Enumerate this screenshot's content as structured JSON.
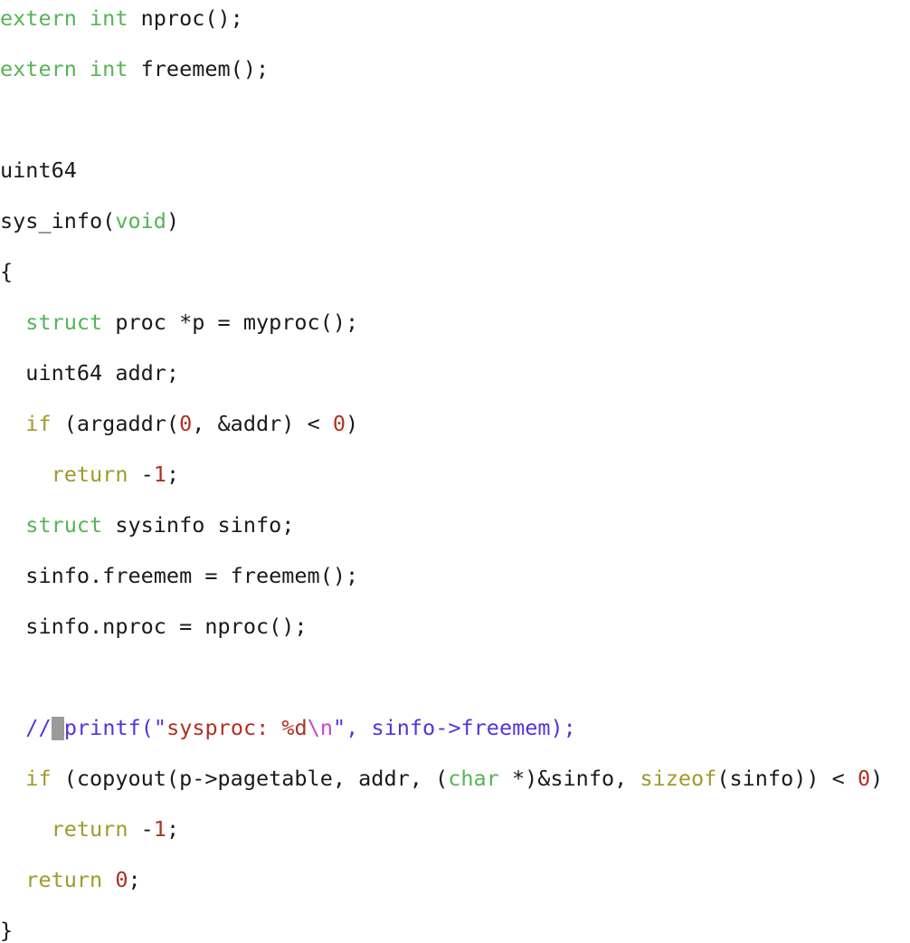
{
  "editor": {
    "background_color": "#ffffff",
    "font_size_px": 23.5,
    "line_height_px": 28,
    "cursor": {
      "name": "text-cursor-block",
      "color": "#9a9a9a",
      "line_index": 13,
      "column": 4
    }
  },
  "theme": {
    "plain": "#1a1a1a",
    "type_keyword": "#55b555",
    "control_keyword": "#a09a2c",
    "number": "#b03122",
    "comment": "#5533dd",
    "string": "#b03122",
    "escape": "#cc44cc"
  },
  "code": {
    "language": "c",
    "plain_text": "extern int nproc();\nextern int freemem();\n\nuint64\nsys_info(void)\n{\n  struct proc *p = myproc();\n  uint64 addr;\n  if (argaddr(0, &addr) < 0)\n    return -1;\n  struct sysinfo sinfo;\n  sinfo.freemem = freemem();\n  sinfo.nproc = nproc();\n\n  // printf(\"sysproc: %d\\n\", sinfo->freemem);\n  if (copyout(p->pagetable, addr, (char *)&sinfo, sizeof(sinfo)) < 0)\n    return -1;\n  return 0;\n}",
    "lines": [
      {
        "n": 1,
        "tokens": [
          {
            "t": "extern int",
            "c": "type"
          },
          {
            "t": " nproc();",
            "c": "plain"
          }
        ]
      },
      {
        "n": 2,
        "tokens": [
          {
            "t": "extern int",
            "c": "type"
          },
          {
            "t": " freemem();",
            "c": "plain"
          }
        ]
      },
      {
        "n": 3,
        "tokens": [
          {
            "t": "",
            "c": "plain"
          }
        ]
      },
      {
        "n": 4,
        "tokens": [
          {
            "t": "uint64",
            "c": "plain"
          }
        ]
      },
      {
        "n": 5,
        "tokens": [
          {
            "t": "sys_info(",
            "c": "plain"
          },
          {
            "t": "void",
            "c": "type"
          },
          {
            "t": ")",
            "c": "plain"
          }
        ]
      },
      {
        "n": 6,
        "tokens": [
          {
            "t": "{",
            "c": "plain"
          }
        ]
      },
      {
        "n": 7,
        "tokens": [
          {
            "t": "  ",
            "c": "plain"
          },
          {
            "t": "struct",
            "c": "type"
          },
          {
            "t": " proc *p = myproc();",
            "c": "plain"
          }
        ]
      },
      {
        "n": 8,
        "tokens": [
          {
            "t": "  uint64 addr;",
            "c": "plain"
          }
        ]
      },
      {
        "n": 9,
        "tokens": [
          {
            "t": "  ",
            "c": "plain"
          },
          {
            "t": "if",
            "c": "kw"
          },
          {
            "t": " (argaddr(",
            "c": "plain"
          },
          {
            "t": "0",
            "c": "num"
          },
          {
            "t": ", &addr) < ",
            "c": "plain"
          },
          {
            "t": "0",
            "c": "num"
          },
          {
            "t": ")",
            "c": "plain"
          }
        ]
      },
      {
        "n": 10,
        "tokens": [
          {
            "t": "    ",
            "c": "plain"
          },
          {
            "t": "return",
            "c": "kw"
          },
          {
            "t": " -",
            "c": "plain"
          },
          {
            "t": "1",
            "c": "num"
          },
          {
            "t": ";",
            "c": "plain"
          }
        ]
      },
      {
        "n": 11,
        "tokens": [
          {
            "t": "  ",
            "c": "plain"
          },
          {
            "t": "struct",
            "c": "type"
          },
          {
            "t": " sysinfo sinfo;",
            "c": "plain"
          }
        ]
      },
      {
        "n": 12,
        "tokens": [
          {
            "t": "  sinfo.freemem = freemem();",
            "c": "plain"
          }
        ]
      },
      {
        "n": 13,
        "tokens": [
          {
            "t": "  sinfo.nproc = nproc();",
            "c": "plain"
          }
        ]
      },
      {
        "n": 14,
        "tokens": [
          {
            "t": "",
            "c": "plain"
          }
        ]
      },
      {
        "n": 15,
        "tokens": [
          {
            "t": "  ",
            "c": "plain"
          },
          {
            "t": "//",
            "c": "comment"
          },
          {
            "t": " ",
            "c": "cursor"
          },
          {
            "t": "printf(\"",
            "c": "comment"
          },
          {
            "t": "sysproc: %d",
            "c": "string"
          },
          {
            "t": "\\n",
            "c": "escape"
          },
          {
            "t": "\", sinfo->freemem);",
            "c": "comment"
          }
        ]
      },
      {
        "n": 16,
        "tokens": [
          {
            "t": "  ",
            "c": "plain"
          },
          {
            "t": "if",
            "c": "kw"
          },
          {
            "t": " (copyout(p->pagetable, addr, (",
            "c": "plain"
          },
          {
            "t": "char",
            "c": "type"
          },
          {
            "t": " *)&sinfo, ",
            "c": "plain"
          },
          {
            "t": "sizeof",
            "c": "kw"
          },
          {
            "t": "(sinfo)) < ",
            "c": "plain"
          },
          {
            "t": "0",
            "c": "num"
          },
          {
            "t": ")",
            "c": "plain"
          }
        ]
      },
      {
        "n": 17,
        "tokens": [
          {
            "t": "    ",
            "c": "plain"
          },
          {
            "t": "return",
            "c": "kw"
          },
          {
            "t": " -",
            "c": "plain"
          },
          {
            "t": "1",
            "c": "num"
          },
          {
            "t": ";",
            "c": "plain"
          }
        ]
      },
      {
        "n": 18,
        "tokens": [
          {
            "t": "  ",
            "c": "plain"
          },
          {
            "t": "return",
            "c": "kw"
          },
          {
            "t": " ",
            "c": "plain"
          },
          {
            "t": "0",
            "c": "num"
          },
          {
            "t": ";",
            "c": "plain"
          }
        ]
      },
      {
        "n": 19,
        "tokens": [
          {
            "t": "}",
            "c": "plain"
          }
        ]
      }
    ]
  }
}
